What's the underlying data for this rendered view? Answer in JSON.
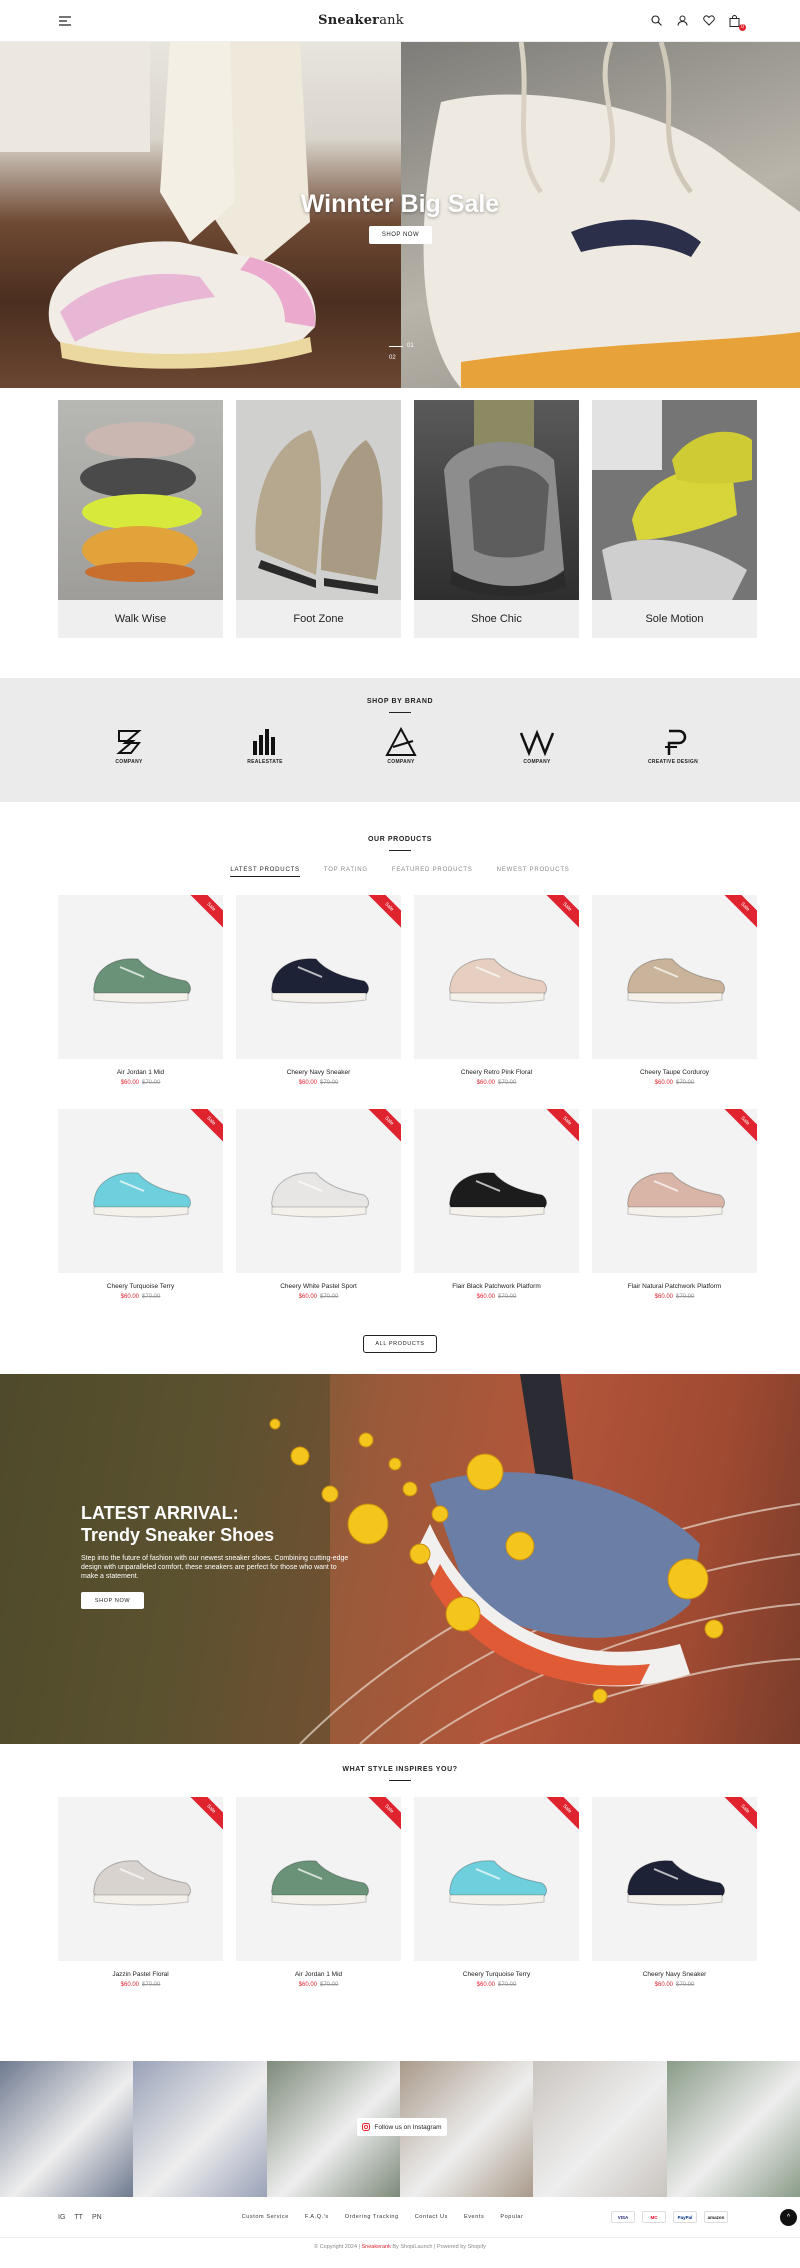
{
  "header": {
    "logo_main": "Sneaker",
    "logo_suffix": "ank",
    "cart_count": "0",
    "icons": [
      "menu-icon",
      "search-icon",
      "user-icon",
      "heart-icon",
      "bag-icon"
    ]
  },
  "hero": {
    "title": "Winnter Big Sale",
    "button": "SHOP NOW",
    "slides": [
      "01",
      "02"
    ]
  },
  "categories": [
    {
      "label": "Walk Wise"
    },
    {
      "label": "Foot Zone"
    },
    {
      "label": "Shoe Chic"
    },
    {
      "label": "Sole Motion"
    }
  ],
  "brands": {
    "title": "SHOP BY BRAND",
    "items": [
      "COMPANY",
      "REALESTATE",
      "COMPANY",
      "COMPANY",
      "CREATIVE DESIGN"
    ]
  },
  "products": {
    "title": "OUR PRODUCTS",
    "tabs": [
      "LATEST PRODUCTS",
      "TOP RATING",
      "FEATURED PRODUCTS",
      "NEWEST PRODUCTS"
    ],
    "sale_label": "Sale",
    "items": [
      {
        "name": "Air Jordan 1 Mid",
        "price": "$60.00",
        "compare": "$70.00",
        "color": "#6a9278"
      },
      {
        "name": "Cheery Navy Sneaker",
        "price": "$60.00",
        "compare": "$70.00",
        "color": "#1e2236"
      },
      {
        "name": "Cheery Retro Pink Floral",
        "price": "$60.00",
        "compare": "$70.00",
        "color": "#e6cfc0"
      },
      {
        "name": "Cheery Taupe Corduroy",
        "price": "$60.00",
        "compare": "$70.00",
        "color": "#c9b39a"
      },
      {
        "name": "Cheery Turquoise Terry",
        "price": "$60.00",
        "compare": "$70.00",
        "color": "#6fd0dd"
      },
      {
        "name": "Cheery White Pastel Sport",
        "price": "$60.00",
        "compare": "$70.00",
        "color": "#e8e5e5"
      },
      {
        "name": "Flair Black Patchwork Platform",
        "price": "$60.00",
        "compare": "$70.00",
        "color": "#1c1c1c"
      },
      {
        "name": "Flair Natural Patchwork Platform",
        "price": "$60.00",
        "compare": "$70.00",
        "color": "#d8b5a6"
      }
    ],
    "all_button": "ALL PRODUCTS"
  },
  "promo": {
    "heading_1": "LATEST ARRIVAL:",
    "heading_2": "Trendy Sneaker Shoes",
    "text": "Step into the future of fashion with our newest sneaker shoes. Combining cutting-edge design with unparalleled comfort, these sneakers are perfect for those who want to make a statement.",
    "button": "SHOP NOW"
  },
  "style": {
    "title": "WHAT STYLE INSPIRES YOU?",
    "items": [
      {
        "name": "Jazzin Pastel Floral",
        "price": "$60.00",
        "compare": "$70.00",
        "color": "#d8d3cf"
      },
      {
        "name": "Air Jordan 1 Mid",
        "price": "$60.00",
        "compare": "$70.00",
        "color": "#6a9278"
      },
      {
        "name": "Cheery Turquoise Terry",
        "price": "$60.00",
        "compare": "$70.00",
        "color": "#6fd0dd"
      },
      {
        "name": "Cheery Navy Sneaker",
        "price": "$60.00",
        "compare": "$70.00",
        "color": "#1e2236"
      }
    ]
  },
  "instagram": {
    "label": "Follow us on Instagram",
    "tiles": [
      "#6f7a90",
      "#9aa2b8",
      "#7d8a7a",
      "#a99a8a",
      "#c9c4bf",
      "#8a9c88"
    ]
  },
  "footer": {
    "social": [
      "IG",
      "TT",
      "PN"
    ],
    "menu": [
      "Custom Service",
      "F.A.Q.'s",
      "Ordering Tracking",
      "Contact Us",
      "Events",
      "Popular"
    ],
    "payments": [
      "VISA",
      "MC",
      "PayPal",
      "amazon"
    ],
    "top_icon": "^",
    "copy_prefix": "© Copyright 2024 |",
    "copy_brand": "Sneakerank",
    "copy_by": "By ShopiLaunch",
    "copy_powered": "Powered by Shopify"
  },
  "colors": {
    "accent": "#e0242f",
    "text": "#222222"
  }
}
